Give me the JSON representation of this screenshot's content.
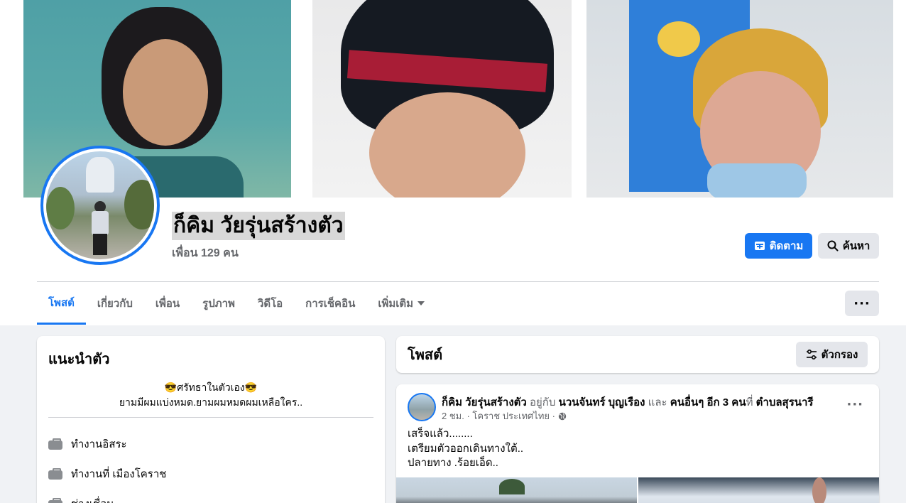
{
  "profile": {
    "name": "ก็คิม วัยรุ่นสร้างตัว",
    "friends": "เพื่อน 129 คน"
  },
  "actions": {
    "follow_label": "ติดตาม",
    "search_label": "ค้นหา"
  },
  "tabs": [
    {
      "label": "โพสต์",
      "active": true
    },
    {
      "label": "เกี่ยวกับ"
    },
    {
      "label": "เพื่อน"
    },
    {
      "label": "รูปภาพ"
    },
    {
      "label": "วิดีโอ"
    },
    {
      "label": "การเช็คอิน"
    },
    {
      "label": "เพิ่มเติม"
    }
  ],
  "intro": {
    "title": "แนะนำตัว",
    "bio_line1": "😎ศรัทธาในตัวเอง😎",
    "bio_line2": "ยามมีผมแบ่งหมด.ยามผมหมดผมเหลือใคร..",
    "items": [
      "ทำงานอิสระ",
      "ทำงานที่ เมืองโคราช",
      "ช่างเชื่อม"
    ]
  },
  "posts_section": {
    "title": "โพสต์",
    "filter_label": "ตัวกรอง"
  },
  "post": {
    "author": "ก็คิม วัยรุ่นสร้างตัว",
    "with_word": "อยู่กับ",
    "tagged": "นวนจันทร์ บุญเรือง",
    "and_word": "และ",
    "others": "คนอื่นๆ อีก 3 คน",
    "at_word": "ที่",
    "place": "ตำบลสุรนารี",
    "meta": "2 ชม. · โคราช ประเทศไทย ·",
    "text_line1": "เสร็จแล้ว........",
    "text_line2": "เตรียมตัวออกเดินทางใต้..",
    "text_line3": "ปลายทาง .ร้อยเอ็ด.."
  },
  "colors": {
    "accent": "#1877f2",
    "secondary_button": "#e4e6eb",
    "muted_text": "#65676b",
    "page_bg": "#f0f2f5"
  }
}
